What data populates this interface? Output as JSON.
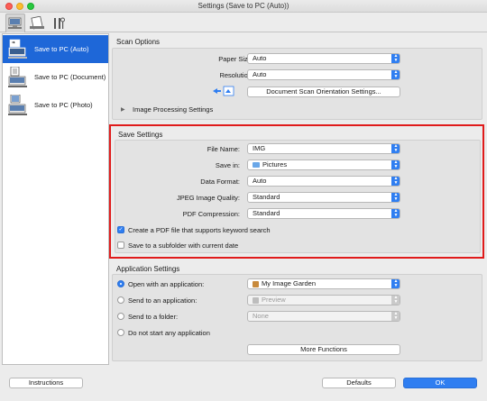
{
  "window": {
    "title": "Settings (Save to PC (Auto))"
  },
  "toolbar": {
    "tabs": [
      {
        "name": "scan-from-computer-tab",
        "icon": "computer-scan-icon"
      },
      {
        "name": "scan-from-panel-tab",
        "icon": "document-scan-icon"
      },
      {
        "name": "general-settings-tab",
        "icon": "tools-icon"
      }
    ]
  },
  "sidebar": {
    "items": [
      {
        "label": "Save to PC (Auto)",
        "selected": true
      },
      {
        "label": "Save to PC (Document)",
        "selected": false
      },
      {
        "label": "Save to PC (Photo)",
        "selected": false
      }
    ]
  },
  "scan_options": {
    "title": "Scan Options",
    "paper_size_label": "Paper Size:",
    "paper_size_value": "Auto",
    "resolution_label": "Resolution:",
    "resolution_value": "Auto",
    "orientation_button": "Document Scan Orientation Settings...",
    "image_processing_label": "Image Processing Settings"
  },
  "save_settings": {
    "title": "Save Settings",
    "file_name_label": "File Name:",
    "file_name_value": "IMG",
    "save_in_label": "Save in:",
    "save_in_value": "Pictures",
    "data_format_label": "Data Format:",
    "data_format_value": "Auto",
    "jpeg_quality_label": "JPEG Image Quality:",
    "jpeg_quality_value": "Standard",
    "pdf_compression_label": "PDF Compression:",
    "pdf_compression_value": "Standard",
    "pdf_keyword_label": "Create a PDF file that supports keyword search",
    "pdf_keyword_checked": true,
    "subfolder_label": "Save to a subfolder with current date",
    "subfolder_checked": false
  },
  "application_settings": {
    "title": "Application Settings",
    "open_app_label": "Open with an application:",
    "open_app_value": "My Image Garden",
    "send_app_label": "Send to an application:",
    "send_app_value": "Preview",
    "send_folder_label": "Send to a folder:",
    "send_folder_value": "None",
    "no_app_label": "Do not start any application",
    "more_functions_button": "More Functions",
    "selected_option": "open_app"
  },
  "footer": {
    "instructions_button": "Instructions",
    "defaults_button": "Defaults",
    "ok_button": "OK"
  },
  "colors": {
    "accent": "#2f7ef1",
    "selection": "#1e67d8",
    "highlight": "#e01b1b"
  }
}
